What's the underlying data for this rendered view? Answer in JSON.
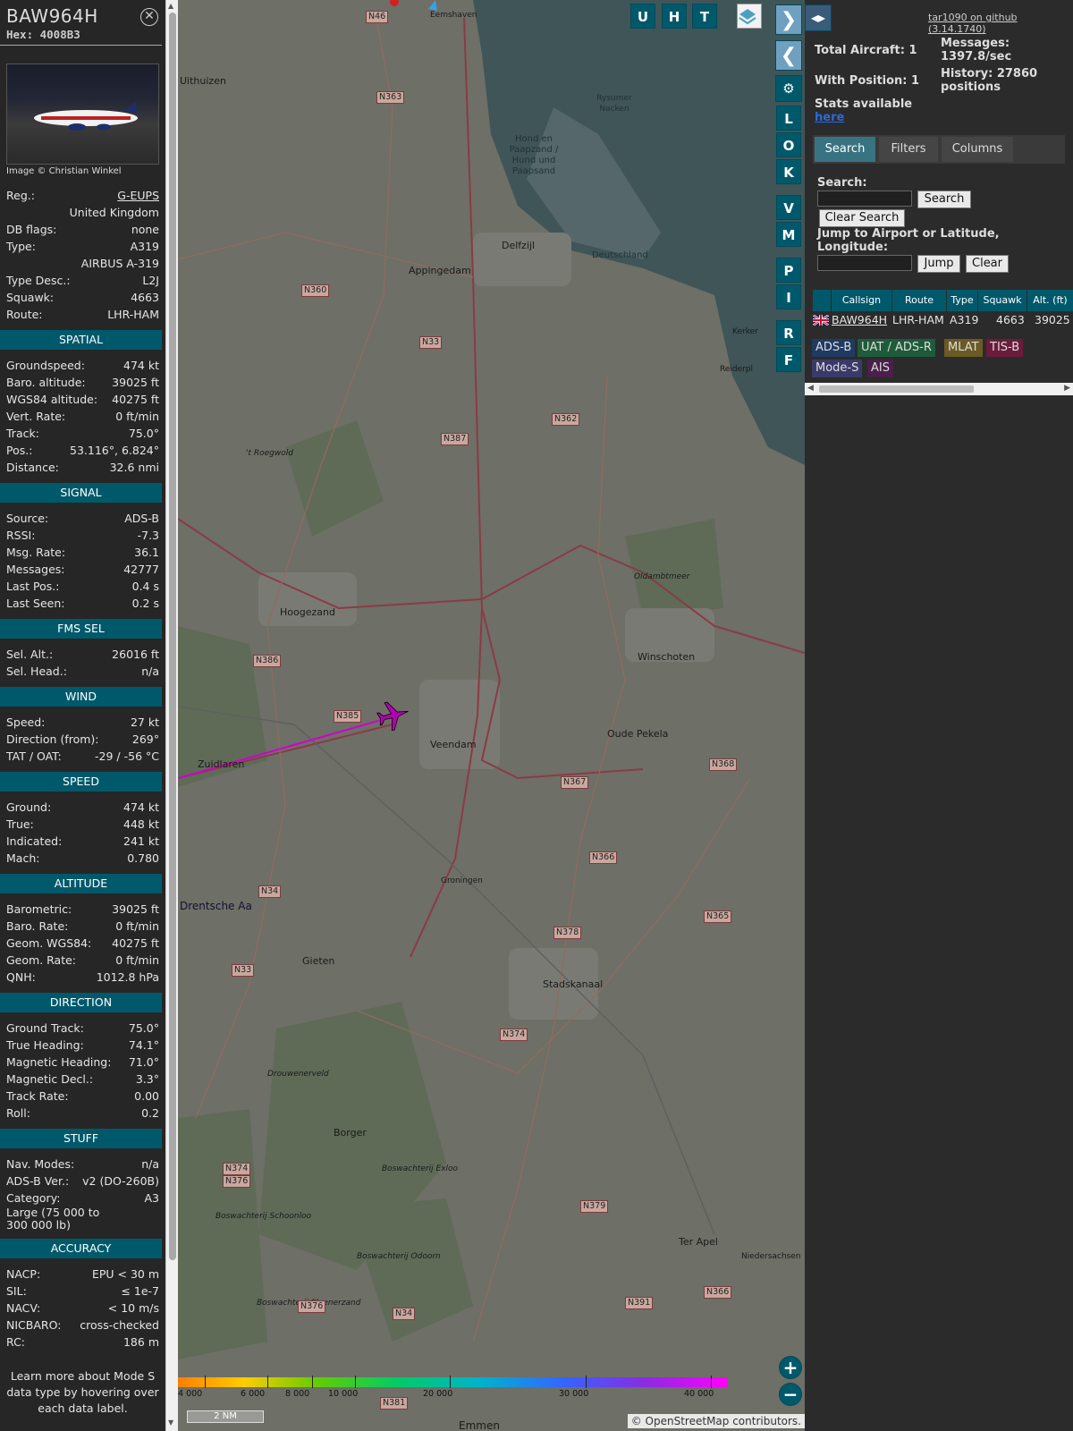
{
  "aircraft": {
    "callsign": "BAW964H",
    "hex": "Hex: 4008B3",
    "photo_credit": "Image © Christian Winkel"
  },
  "info": [
    {
      "k": "Reg.:",
      "v": "G-EUPS"
    },
    {
      "k": "",
      "v": "United Kingdom"
    },
    {
      "k": "DB flags:",
      "v": "none"
    },
    {
      "k": "Type:",
      "v": "A319"
    },
    {
      "k": "",
      "v": "AIRBUS A-319"
    },
    {
      "k": "Type Desc.:",
      "v": "L2J"
    },
    {
      "k": "Squawk:",
      "v": "4663"
    },
    {
      "k": "Route:",
      "v": "LHR-HAM"
    }
  ],
  "sections": [
    {
      "title": "SPATIAL",
      "rows": [
        {
          "k": "Groundspeed:",
          "v": "474 kt"
        },
        {
          "k": "Baro. altitude:",
          "v": "39025 ft"
        },
        {
          "k": "WGS84 altitude:",
          "v": "40275 ft"
        },
        {
          "k": "Vert. Rate:",
          "v": "0 ft/min"
        },
        {
          "k": "Track:",
          "v": "75.0°"
        },
        {
          "k": "Pos.:",
          "v": "53.116°, 6.824°"
        },
        {
          "k": "Distance:",
          "v": "32.6 nmi"
        }
      ]
    },
    {
      "title": "SIGNAL",
      "rows": [
        {
          "k": "Source:",
          "v": "ADS-B"
        },
        {
          "k": "RSSI:",
          "v": "-7.3"
        },
        {
          "k": "Msg. Rate:",
          "v": "36.1"
        },
        {
          "k": "Messages:",
          "v": "42777"
        },
        {
          "k": "Last Pos.:",
          "v": "0.4 s"
        },
        {
          "k": "Last Seen:",
          "v": "0.2 s"
        }
      ]
    },
    {
      "title": "FMS SEL",
      "rows": [
        {
          "k": "Sel. Alt.:",
          "v": "26016 ft"
        },
        {
          "k": "Sel. Head.:",
          "v": "n/a"
        }
      ]
    },
    {
      "title": "WIND",
      "rows": [
        {
          "k": "Speed:",
          "v": "27 kt"
        },
        {
          "k": "Direction (from):",
          "v": "269°"
        },
        {
          "k": "TAT / OAT:",
          "v": "-29 / -56 °C"
        }
      ]
    },
    {
      "title": "SPEED",
      "rows": [
        {
          "k": "Ground:",
          "v": "474 kt"
        },
        {
          "k": "True:",
          "v": "448 kt"
        },
        {
          "k": "Indicated:",
          "v": "241 kt"
        },
        {
          "k": "Mach:",
          "v": "0.780"
        }
      ]
    },
    {
      "title": "ALTITUDE",
      "rows": [
        {
          "k": "Barometric:",
          "v": "39025 ft"
        },
        {
          "k": "Baro. Rate:",
          "v": "0 ft/min"
        },
        {
          "k": "Geom. WGS84:",
          "v": "40275 ft"
        },
        {
          "k": "Geom. Rate:",
          "v": "0 ft/min"
        },
        {
          "k": "QNH:",
          "v": "1012.8 hPa"
        }
      ]
    },
    {
      "title": "DIRECTION",
      "rows": [
        {
          "k": "Ground Track:",
          "v": "75.0°"
        },
        {
          "k": "True Heading:",
          "v": "74.1°"
        },
        {
          "k": "Magnetic Heading:",
          "v": "71.0°"
        },
        {
          "k": "Magnetic Decl.:",
          "v": "3.3°"
        },
        {
          "k": "Track Rate:",
          "v": "0.00"
        },
        {
          "k": "Roll:",
          "v": "0.2"
        }
      ]
    },
    {
      "title": "STUFF",
      "rows": [
        {
          "k": "Nav. Modes:",
          "v": "n/a"
        },
        {
          "k": "ADS-B Ver.:",
          "v": "v2 (DO-260B)"
        },
        {
          "k": "Category:",
          "v": "A3"
        },
        {
          "k": "Large (75 000 to 300 000 lb)",
          "v": ""
        }
      ]
    },
    {
      "title": "ACCURACY",
      "rows": [
        {
          "k": "NACP:",
          "v": "EPU < 30 m"
        },
        {
          "k": "SIL:",
          "v": "≤ 1e-7"
        },
        {
          "k": "NACV:",
          "v": "< 10 m/s"
        },
        {
          "k": "NICBARO:",
          "v": "cross-checked"
        },
        {
          "k": "RC:",
          "v": "186 m"
        }
      ]
    }
  ],
  "learn_more": "Learn more about Mode S data type by hovering over each data label.",
  "map": {
    "buttons": [
      "U",
      "H",
      "T"
    ],
    "side_buttons": [
      "L",
      "O",
      "K",
      "V",
      "M",
      "P",
      "I",
      "R",
      "F"
    ],
    "places": [
      "Eemshaven",
      "Uithuizen",
      "Delfzijl",
      "Appingedam",
      "Hoogezand",
      "Winschoten",
      "Veendam",
      "Oude Pekela",
      "Zuidlaren",
      "Stadskanaal",
      "Gieten",
      "Borger",
      "Ter Apel",
      "Emmen",
      "Drentsche Aa",
      "Oldambtmeer",
      "Drouwenerveld",
      "Boswachterij Exloo",
      "Boswachterij Odoorn",
      "Boswachterij Schoonloo",
      "Boswachterij Sleenerzand",
      "Hond en Paapzand / Hund und Paapsand",
      "Rysumer Nacken",
      "Deutschland",
      "'t Roegwold",
      "Groningen",
      "Niedersachsen",
      "Kerker",
      "Reiderpl"
    ],
    "roads": [
      "N46",
      "N363",
      "N360",
      "N33",
      "N362",
      "N387",
      "N386",
      "N385",
      "N367",
      "N368",
      "N366",
      "N34",
      "N378",
      "N365",
      "N33",
      "N374",
      "N379",
      "N374",
      "N376",
      "N376",
      "N34",
      "N391",
      "N366",
      "N381"
    ],
    "altitude_scale": [
      "4 000",
      "6 000",
      "8 000",
      "10 000",
      "20 000",
      "30 000",
      "40 000"
    ],
    "scale": "2 NM",
    "attribution": "© OpenStreetMap contributors."
  },
  "stats": {
    "total_aircraft": "Total Aircraft: 1",
    "with_position": "With Position: 1",
    "stats_available": "Stats available",
    "here": "here",
    "messages": "Messages: 1397.8/sec",
    "history": "History: 27860 positions",
    "github": "tar1090 on github (3.14.1740)"
  },
  "tabs": [
    "Search",
    "Filters",
    "Columns"
  ],
  "search": {
    "label": "Search:",
    "button": "Search",
    "clear_search": "Clear Search",
    "jump_label": "Jump to Airport or Latitude, Longitude:",
    "jump": "Jump",
    "clear": "Clear"
  },
  "table": {
    "headers": [
      "Callsign",
      "Route",
      "Type",
      "Squawk",
      "Alt. (ft)"
    ],
    "row": {
      "callsign": "BAW964H",
      "route": "LHR-HAM",
      "type": "A319",
      "squawk": "4663",
      "alt": "39025"
    }
  },
  "legend": [
    "ADS-B",
    "UAT / ADS-R",
    "MLAT",
    "TIS-B",
    "Mode-S",
    "AIS"
  ],
  "colors": {
    "section": "#00596b",
    "adsb": "#1f3b63",
    "uat": "#1e5b3a",
    "mlat": "#6b5a23",
    "tisb": "#6a1c3a",
    "modes": "#3a3a6a",
    "ais": "#4b1f4b",
    "track": "#d000d0"
  }
}
